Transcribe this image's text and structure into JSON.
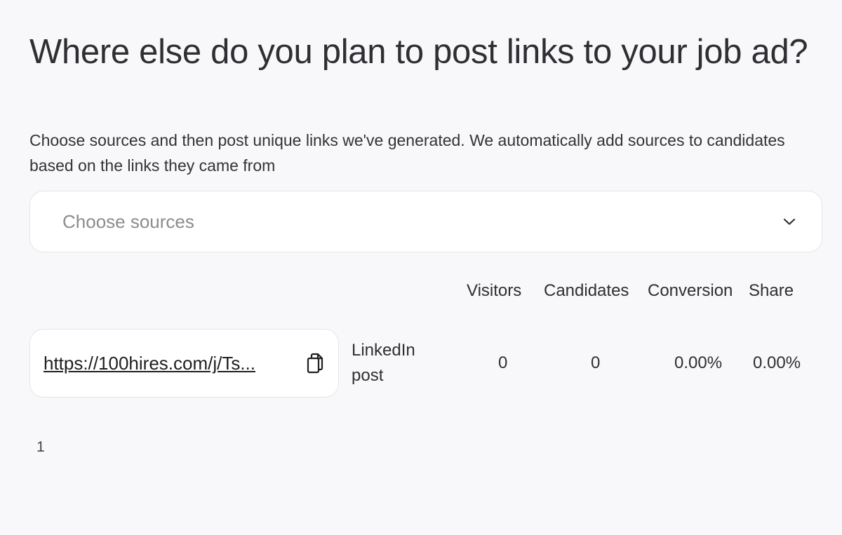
{
  "heading": {
    "title": "Where else do you plan to post links to your job ad?",
    "subtitle": "Choose sources and then post unique links we've generated. We automatically add sources to candidates based on the links they came from"
  },
  "sources_select": {
    "placeholder": "Choose sources",
    "icon": "chevron-down-icon"
  },
  "table": {
    "columns": [
      "Visitors",
      "Candidates",
      "Conversion",
      "Share"
    ],
    "rows": [
      {
        "link": "https://100hires.com/j/Ts...",
        "copy_icon": "copy-icon",
        "source": "LinkedIn post",
        "visitors": "0",
        "candidates": "0",
        "conversion": "0.00%",
        "share": "0.00%"
      }
    ]
  },
  "pagination": {
    "current_page": "1"
  }
}
